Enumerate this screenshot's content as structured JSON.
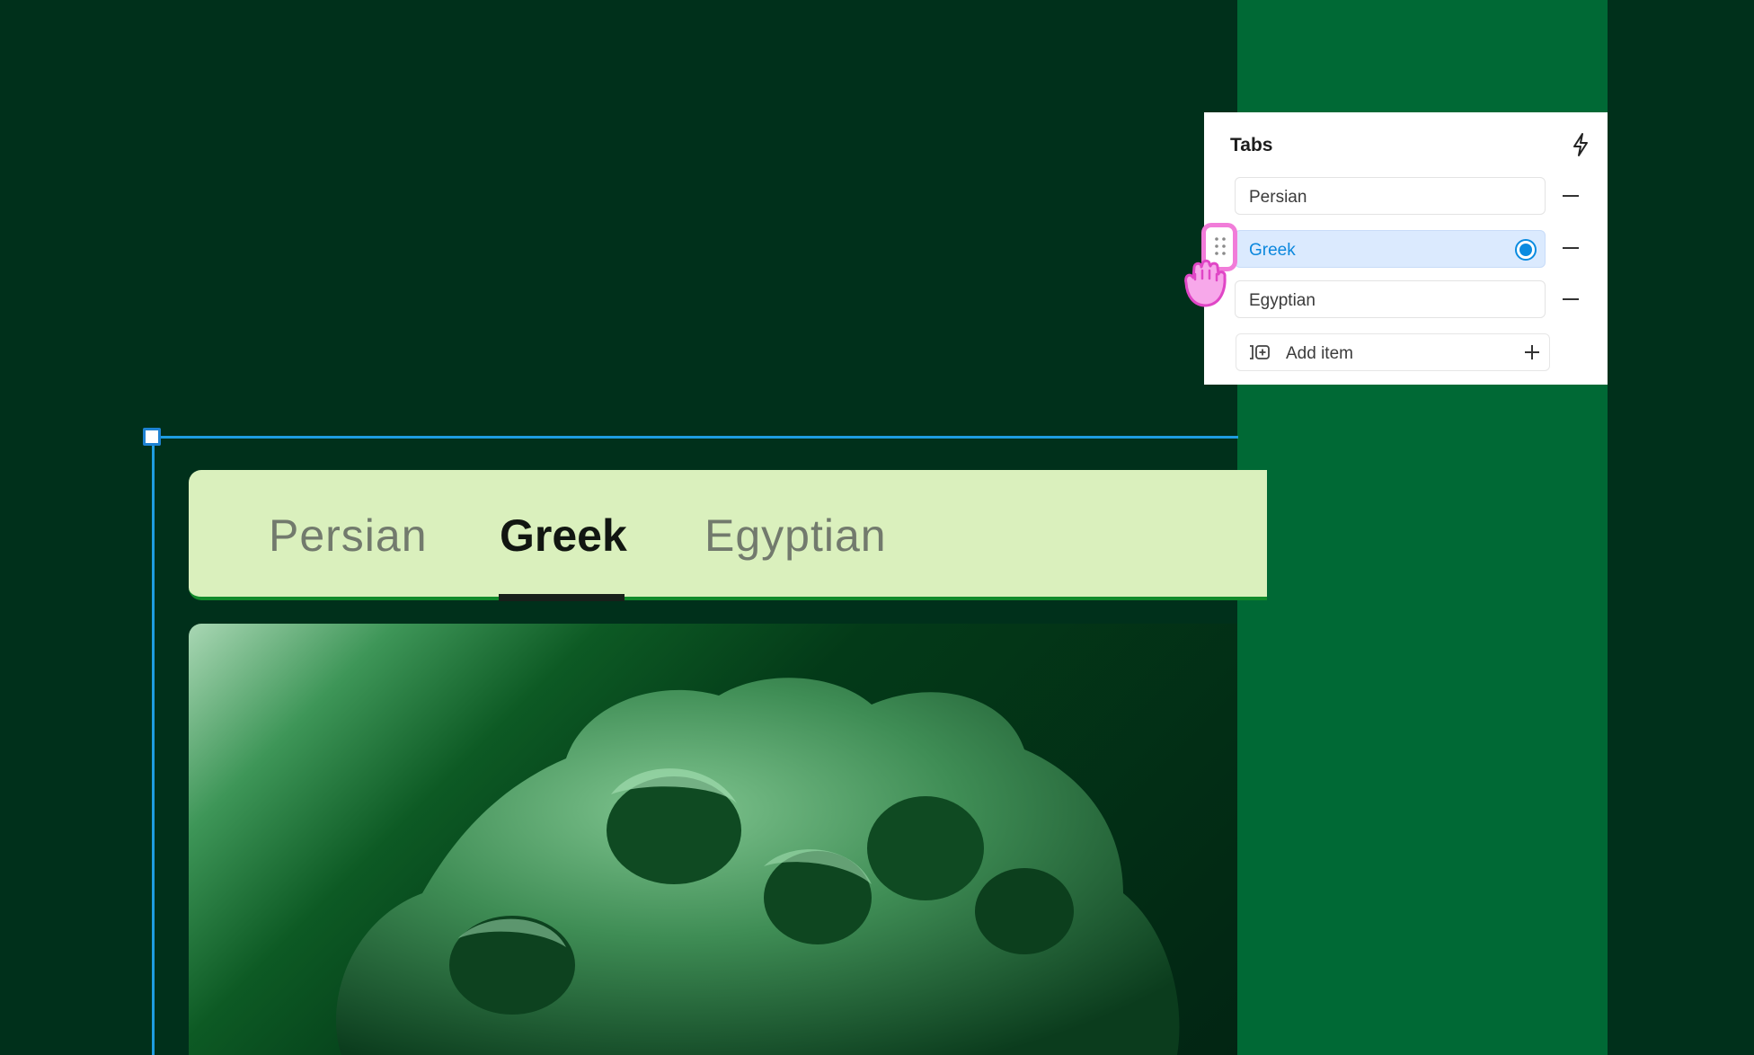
{
  "canvas": {
    "tabs": [
      {
        "label": "Persian",
        "active": false
      },
      {
        "label": "Greek",
        "active": true
      },
      {
        "label": "Egyptian",
        "active": false
      }
    ]
  },
  "panel": {
    "title": "Tabs",
    "title_icon": "bolt-icon",
    "items": [
      {
        "label": "Persian",
        "selected": false
      },
      {
        "label": "Greek",
        "selected": true
      },
      {
        "label": "Egyptian",
        "selected": false
      }
    ],
    "add_label": "Add item"
  },
  "colors": {
    "background": "#00301b",
    "column": "#006935",
    "tabbar": "#daf0bd",
    "selection": "#1e9de0",
    "accent": "#0a8be0",
    "drag_highlight": "#f17cd9"
  }
}
